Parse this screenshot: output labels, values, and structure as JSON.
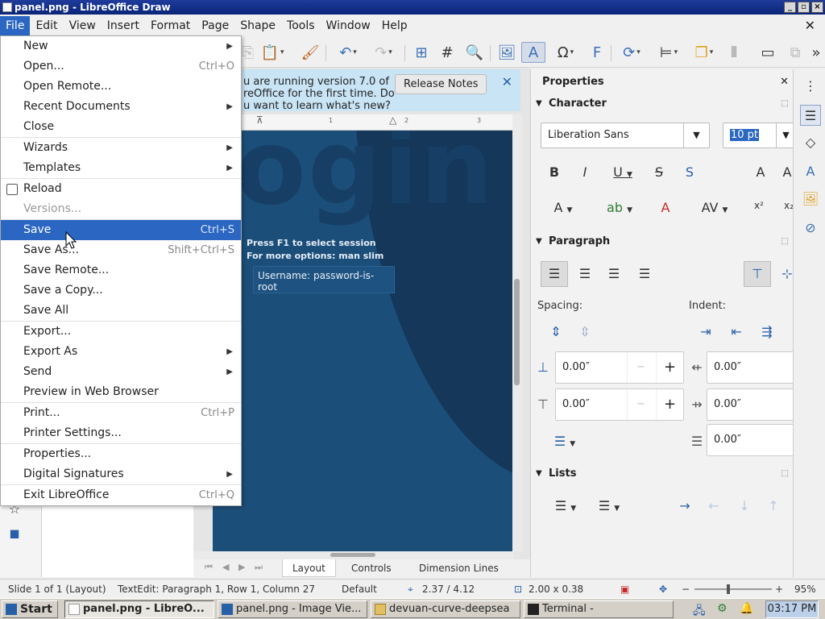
{
  "window": {
    "title": "panel.png - LibreOffice Draw",
    "min": "_",
    "max": "▫",
    "close": "×"
  },
  "menubar": {
    "items": [
      "File",
      "Edit",
      "View",
      "Insert",
      "Format",
      "Page",
      "Shape",
      "Tools",
      "Window",
      "Help"
    ],
    "close_doc": "✕"
  },
  "infobar": {
    "text": "u are running version 7.0 of reOffice for the first time. Do u want to learn what's new?",
    "button": "Release Notes",
    "close": "✕"
  },
  "ruler": {
    "ticks": [
      "1",
      "2",
      "3"
    ]
  },
  "page": {
    "big_text": "ogin",
    "line1": "Press F1 to select session",
    "line2": "For more options: man slim",
    "field": "Username: password-is-root"
  },
  "file_menu": {
    "items": [
      {
        "label": "New",
        "shortcut": "",
        "submenu": true
      },
      {
        "label": "Open...",
        "shortcut": "Ctrl+O"
      },
      {
        "label": "Open Remote...",
        "shortcut": ""
      },
      {
        "label": "Recent Documents",
        "shortcut": "",
        "submenu": true
      },
      {
        "label": "Close",
        "shortcut": ""
      },
      {
        "label": "Wizards",
        "shortcut": "",
        "submenu": true
      },
      {
        "label": "Templates",
        "shortcut": "",
        "submenu": true
      },
      {
        "label": "Reload",
        "shortcut": ""
      },
      {
        "label": "Versions...",
        "shortcut": "",
        "disabled": true
      },
      {
        "label": "Save",
        "shortcut": "Ctrl+S",
        "highlighted": true
      },
      {
        "label": "Save As...",
        "shortcut": "Shift+Ctrl+S"
      },
      {
        "label": "Save Remote...",
        "shortcut": ""
      },
      {
        "label": "Save a Copy...",
        "shortcut": ""
      },
      {
        "label": "Save All",
        "shortcut": ""
      },
      {
        "label": "Export...",
        "shortcut": ""
      },
      {
        "label": "Export As",
        "shortcut": "",
        "submenu": true
      },
      {
        "label": "Send",
        "shortcut": "",
        "submenu": true
      },
      {
        "label": "Preview in Web Browser",
        "shortcut": ""
      },
      {
        "label": "Print...",
        "shortcut": "Ctrl+P"
      },
      {
        "label": "Printer Settings...",
        "shortcut": ""
      },
      {
        "label": "Properties...",
        "shortcut": ""
      },
      {
        "label": "Digital Signatures",
        "shortcut": "",
        "submenu": true
      },
      {
        "label": "Exit LibreOffice",
        "shortcut": "Ctrl+Q"
      }
    ]
  },
  "sidebar": {
    "title": "Properties",
    "close": "✕",
    "character": {
      "title": "Character",
      "font": "Liberation Sans",
      "size": "10 pt"
    },
    "paragraph": {
      "title": "Paragraph",
      "spacing_label": "Spacing:",
      "indent_label": "Indent:",
      "above": "0.00″",
      "below": "0.00″",
      "before": "0.00″",
      "after": "0.00″",
      "first": "0.00″"
    },
    "lists": {
      "title": "Lists"
    }
  },
  "tabs": {
    "items": [
      "Layout",
      "Controls",
      "Dimension Lines"
    ]
  },
  "statusbar": {
    "slide": "Slide 1 of 1 (Layout)",
    "edit": "TextEdit: Paragraph 1, Row 1, Column 27",
    "style": "Default",
    "position": "2.37 / 4.12",
    "size": "2.00 x 0.38",
    "zoom": "95%"
  },
  "taskbar": {
    "start": "Start",
    "tasks": [
      "panel.png - LibreO...",
      "panel.png - Image Vie...",
      "devuan-curve-deepsea",
      "Terminal -"
    ],
    "clock": "03:17 PM"
  },
  "colors": {
    "accent": "#2a66c2",
    "infobar": "#c9e4f5",
    "page": "#1c4e7a",
    "titlebar": "#1f3c9c"
  }
}
